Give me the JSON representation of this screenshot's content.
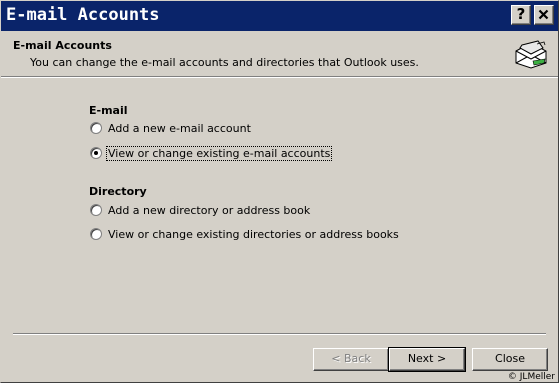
{
  "window": {
    "title": "E-mail Accounts",
    "help_button": "?",
    "close_button": "✕"
  },
  "header": {
    "title": "E-mail Accounts",
    "subtitle": "You can change the e-mail accounts and directories that Outlook uses.",
    "icon": "mail-envelope-icon"
  },
  "email_group": {
    "title": "E-mail",
    "options": [
      {
        "label": "Add a new e-mail account",
        "checked": false
      },
      {
        "label": "View or change existing e-mail accounts",
        "checked": true
      }
    ]
  },
  "directory_group": {
    "title": "Directory",
    "options": [
      {
        "label": "Add a new directory or address book",
        "checked": false
      },
      {
        "label": "View or change existing directories or address books",
        "checked": false
      }
    ]
  },
  "buttons": {
    "back": "< Back",
    "next": "Next >",
    "close": "Close"
  },
  "credit": "© JLMeller"
}
